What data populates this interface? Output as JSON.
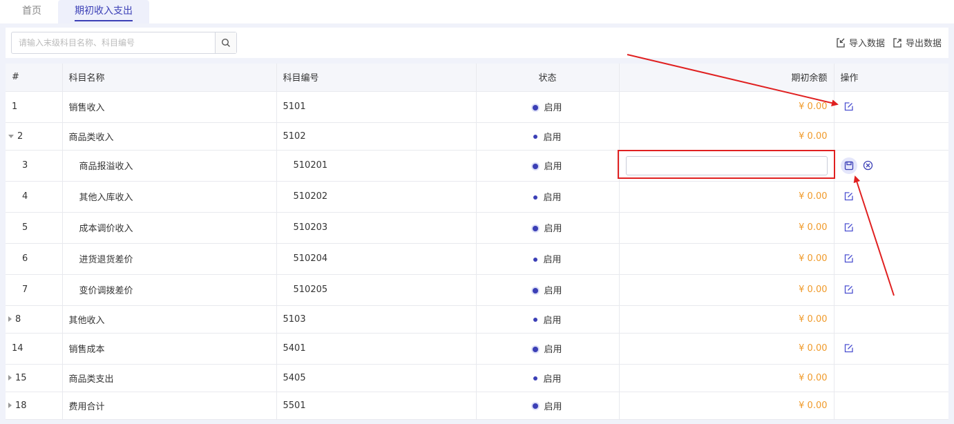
{
  "tabs": [
    {
      "label": "首页"
    },
    {
      "label": "期初收入支出"
    }
  ],
  "search": {
    "placeholder": "请输入末级科目名称、科目编号"
  },
  "toolbar": {
    "import_label": "导入数据",
    "export_label": "导出数据"
  },
  "table": {
    "columns": [
      "#",
      "科目名称",
      "科目编号",
      "状态",
      "期初余额",
      "操作"
    ],
    "rows": [
      {
        "num": "1",
        "name": "销售收入",
        "code": "5101",
        "status": "启用",
        "amount": "¥ 0.00",
        "tree": "none",
        "child": false,
        "action": "edit"
      },
      {
        "num": "2",
        "name": "商品类收入",
        "code": "5102",
        "status": "启用",
        "amount": "¥ 0.00",
        "tree": "open",
        "child": false,
        "action": "none"
      },
      {
        "num": "3",
        "name": "商品报溢收入",
        "code": "510201",
        "status": "启用",
        "amount": "",
        "tree": "none",
        "child": true,
        "action": "editing"
      },
      {
        "num": "4",
        "name": "其他入库收入",
        "code": "510202",
        "status": "启用",
        "amount": "¥ 0.00",
        "tree": "none",
        "child": true,
        "action": "edit"
      },
      {
        "num": "5",
        "name": "成本调价收入",
        "code": "510203",
        "status": "启用",
        "amount": "¥ 0.00",
        "tree": "none",
        "child": true,
        "action": "edit"
      },
      {
        "num": "6",
        "name": "进货退货差价",
        "code": "510204",
        "status": "启用",
        "amount": "¥ 0.00",
        "tree": "none",
        "child": true,
        "action": "edit"
      },
      {
        "num": "7",
        "name": "变价调拨差价",
        "code": "510205",
        "status": "启用",
        "amount": "¥ 0.00",
        "tree": "none",
        "child": true,
        "action": "edit"
      },
      {
        "num": "8",
        "name": "其他收入",
        "code": "5103",
        "status": "启用",
        "amount": "¥ 0.00",
        "tree": "closed",
        "child": false,
        "action": "none"
      },
      {
        "num": "14",
        "name": "销售成本",
        "code": "5401",
        "status": "启用",
        "amount": "¥ 0.00",
        "tree": "none",
        "child": false,
        "action": "edit"
      },
      {
        "num": "15",
        "name": "商品类支出",
        "code": "5405",
        "status": "启用",
        "amount": "¥ 0.00",
        "tree": "closed",
        "child": false,
        "action": "none"
      },
      {
        "num": "18",
        "name": "费用合计",
        "code": "5501",
        "status": "启用",
        "amount": "¥ 0.00",
        "tree": "closed",
        "child": false,
        "action": "none"
      }
    ]
  },
  "colors": {
    "accent": "#3b3fb6",
    "amount": "#f09a2a",
    "annotation": "#e02020"
  }
}
